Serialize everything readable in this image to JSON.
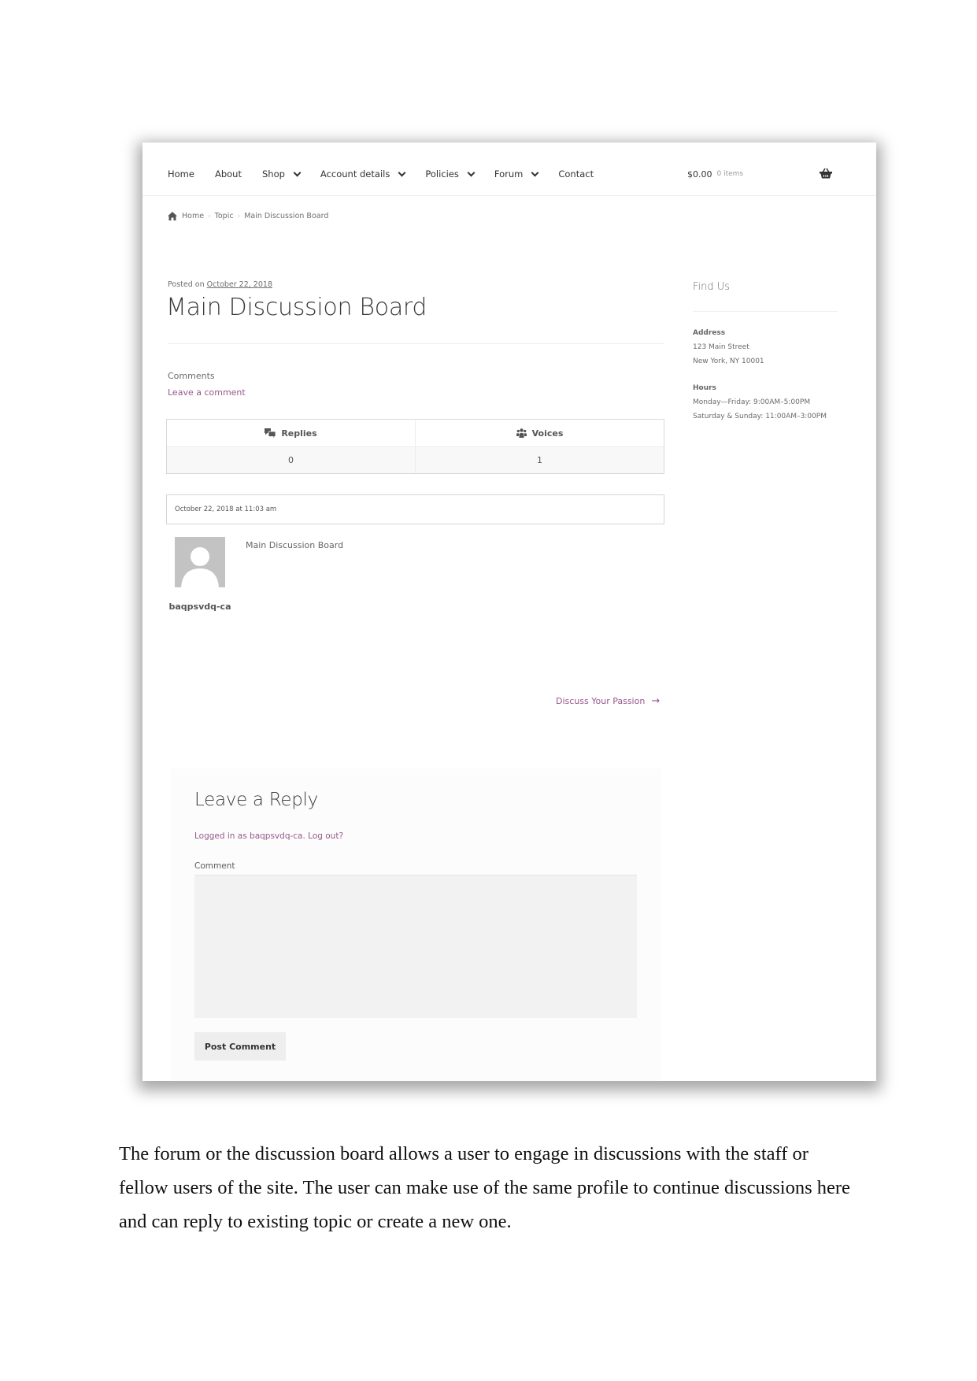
{
  "site": {
    "nav": [
      {
        "label": "Home",
        "has_dropdown": false
      },
      {
        "label": "About",
        "has_dropdown": false
      },
      {
        "label": "Shop",
        "has_dropdown": true
      },
      {
        "label": "Account details",
        "has_dropdown": true
      },
      {
        "label": "Policies",
        "has_dropdown": true
      },
      {
        "label": "Forum",
        "has_dropdown": true
      },
      {
        "label": "Contact",
        "has_dropdown": false
      }
    ],
    "cart": {
      "total": "$0.00",
      "count": "0 items",
      "icon": "basket-icon"
    }
  },
  "breadcrumb": {
    "icon": "home-icon",
    "items": [
      "Home",
      "Topic",
      "Main Discussion Board"
    ],
    "separator": "›"
  },
  "post": {
    "posted_prefix": "Posted on",
    "date": "October 22, 2018",
    "title": "Main Discussion Board",
    "comments_label": "Comments",
    "leave_comment": "Leave a comment"
  },
  "stats": {
    "headers": [
      {
        "label": "Replies",
        "icon": "comments-icon"
      },
      {
        "label": "Voices",
        "icon": "users-icon"
      }
    ],
    "values": [
      "0",
      "1"
    ]
  },
  "reply": {
    "timestamp": "October 22, 2018 at 11:03 am",
    "author": "baqpsvdq-ca",
    "content": "Main Discussion Board"
  },
  "navigation": {
    "next_label": "Discuss Your Passion",
    "next_icon": "→"
  },
  "comment_form": {
    "title": "Leave a Reply",
    "logged_in_prefix": "Logged in as baqpsvdq-ca.",
    "logout_label": "Log out?",
    "comment_label": "Comment",
    "comment_value": "",
    "submit_label": "Post Comment"
  },
  "sidebar": {
    "title": "Find Us",
    "address_label": "Address",
    "address_lines": [
      "123 Main Street",
      "New York, NY 10001"
    ],
    "hours_label": "Hours",
    "hours_lines": [
      "Monday—Friday: 9:00AM–5:00PM",
      "Saturday & Sunday: 11:00AM–3:00PM"
    ]
  },
  "colors": {
    "link_accent": "#96588a",
    "text": "#404040"
  },
  "document": {
    "paragraph": "The forum or the discussion board allows a user to engage in discussions with the staff or fellow users of the site. The user can make use of the same profile to continue discussions here and can reply to existing topic or create a new one."
  }
}
